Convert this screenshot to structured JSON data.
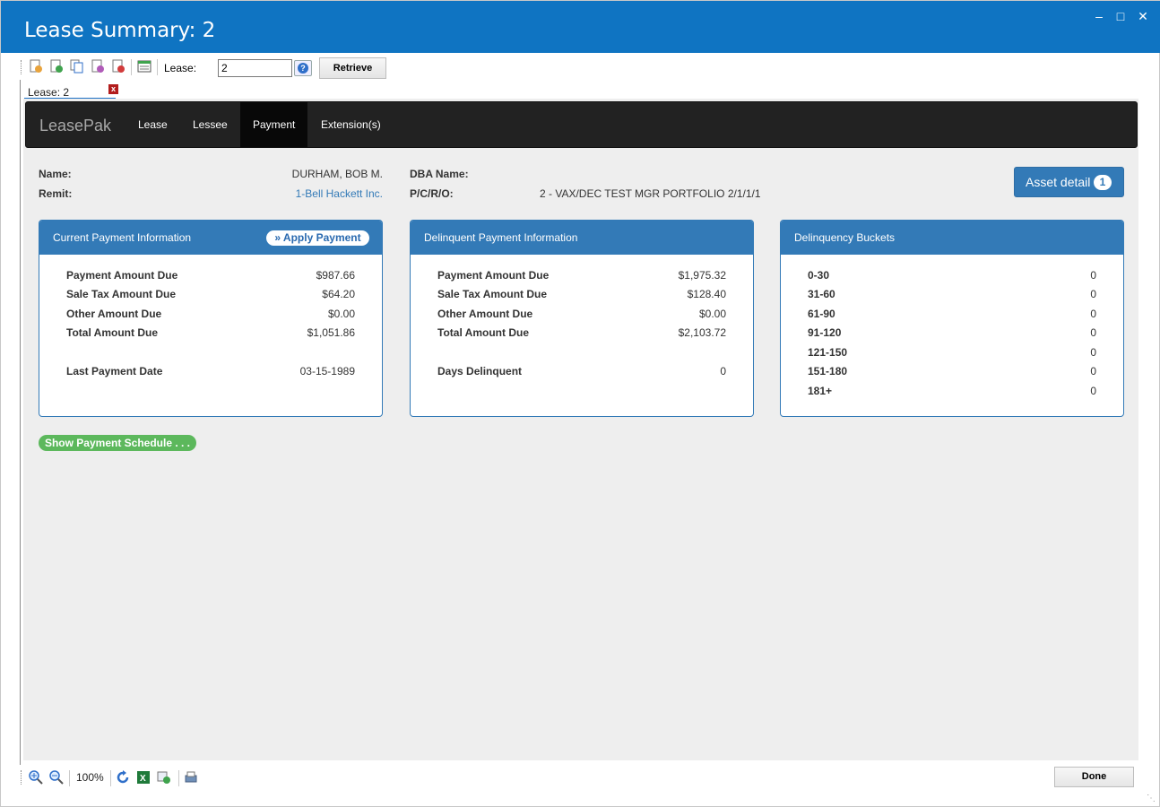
{
  "window": {
    "title": "Lease Summary: 2"
  },
  "toolbar": {
    "lease_label": "Lease:",
    "lease_value": "2",
    "help_label": "?",
    "retrieve_label": "Retrieve"
  },
  "doc_tab": {
    "label": "Lease: 2",
    "close_glyph": "x"
  },
  "nav": {
    "brand": "LeasePak",
    "items": [
      "Lease",
      "Lessee",
      "Payment",
      "Extension(s)"
    ],
    "active": "Payment"
  },
  "info": {
    "name_label": "Name:",
    "name_value": "DURHAM, BOB M.",
    "remit_label": "Remit:",
    "remit_value": "1-Bell Hackett Inc.",
    "dba_label": "DBA Name:",
    "dba_value": "",
    "pcro_label": "P/C/R/O:",
    "pcro_value": "2 - VAX/DEC TEST MGR PORTFOLIO 2/1/1/1"
  },
  "asset_button": {
    "label": "Asset detail",
    "count": "1"
  },
  "current_panel": {
    "title": "Current Payment Information",
    "apply_label": "» Apply Payment",
    "rows": [
      {
        "label": "Payment Amount Due",
        "value": "$987.66"
      },
      {
        "label": "Sale Tax Amount Due",
        "value": "$64.20"
      },
      {
        "label": "Other Amount Due",
        "value": "$0.00"
      },
      {
        "label": "Total Amount Due",
        "value": "$1,051.86"
      }
    ],
    "last_payment_label": "Last Payment Date",
    "last_payment_value": "03-15-1989"
  },
  "delinquent_panel": {
    "title": "Delinquent Payment Information",
    "rows": [
      {
        "label": "Payment Amount Due",
        "value": "$1,975.32"
      },
      {
        "label": "Sale Tax Amount Due",
        "value": "$128.40"
      },
      {
        "label": "Other Amount Due",
        "value": "$0.00"
      },
      {
        "label": "Total Amount Due",
        "value": "$2,103.72"
      }
    ],
    "days_label": "Days Delinquent",
    "days_value": "0"
  },
  "buckets_panel": {
    "title": "Delinquency Buckets",
    "rows": [
      {
        "label": "0-30",
        "value": "0"
      },
      {
        "label": "31-60",
        "value": "0"
      },
      {
        "label": "61-90",
        "value": "0"
      },
      {
        "label": "91-120",
        "value": "0"
      },
      {
        "label": "121-150",
        "value": "0"
      },
      {
        "label": "151-180",
        "value": "0"
      },
      {
        "label": "181+",
        "value": "0"
      }
    ]
  },
  "schedule_button": {
    "label": "Show Payment Schedule . . ."
  },
  "statusbar": {
    "zoom": "100%",
    "done_label": "Done"
  },
  "colors": {
    "titlebar": "#0f74c2",
    "panel_blue": "#337ab7",
    "link": "#337ab7",
    "green_button": "#5cb85c",
    "navbar": "#222222"
  },
  "icons": [
    "new-record-icon",
    "add-icon",
    "copy-icon",
    "user-search-icon",
    "delete-icon",
    "report-icon",
    "zoom-in-icon",
    "zoom-out-icon",
    "refresh-icon",
    "excel-icon",
    "export-icon",
    "print-icon"
  ]
}
